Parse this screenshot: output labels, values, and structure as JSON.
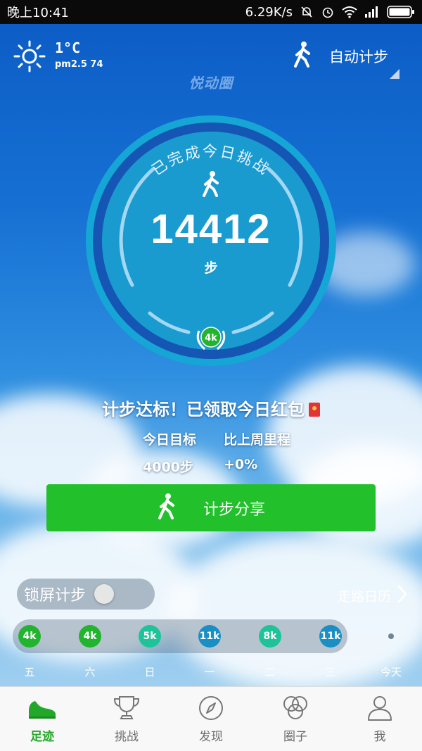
{
  "status_bar": {
    "time": "晚上10:41",
    "net_speed": "6.29K/s"
  },
  "weather": {
    "temperature": "1°C",
    "pm25": "pm2.5 74"
  },
  "header": {
    "auto_step_label": "自动计步",
    "brand": "悦动圈"
  },
  "ring": {
    "challenge_text": "已完成今日挑战",
    "steps": "14412",
    "unit": "步",
    "badge": "4k"
  },
  "goal_status": "计步达标！已领取今日红包",
  "stats": {
    "goal_label": "今日目标",
    "goal_value": "4000步",
    "compare_label": "比上周里程",
    "compare_value": "+0%"
  },
  "share_button": "计步分享",
  "lock_screen": {
    "label": "锁屏计步",
    "enabled": false
  },
  "calendar_link": "走路日历",
  "history": [
    {
      "day": "五",
      "badge": "4k",
      "color": "#23b42f"
    },
    {
      "day": "六",
      "badge": "4k",
      "color": "#23b42f"
    },
    {
      "day": "日",
      "badge": "5k",
      "color": "#1fc39a"
    },
    {
      "day": "一",
      "badge": "11k",
      "color": "#1a8fc4"
    },
    {
      "day": "二",
      "badge": "8k",
      "color": "#1fc39a"
    },
    {
      "day": "三",
      "badge": "11k",
      "color": "#1a8fc4"
    },
    {
      "day": "今天",
      "badge": "",
      "color": ""
    }
  ],
  "tabs": [
    {
      "label": "足迹",
      "icon": "shoe-icon",
      "active": true
    },
    {
      "label": "挑战",
      "icon": "trophy-icon",
      "active": false
    },
    {
      "label": "发现",
      "icon": "compass-icon",
      "active": false
    },
    {
      "label": "圈子",
      "icon": "circles-icon",
      "active": false
    },
    {
      "label": "我",
      "icon": "person-icon",
      "active": false
    }
  ],
  "colors": {
    "accent_green": "#22c02b",
    "ring_blue": "#1a9bd0",
    "active_tab": "#21a828"
  }
}
